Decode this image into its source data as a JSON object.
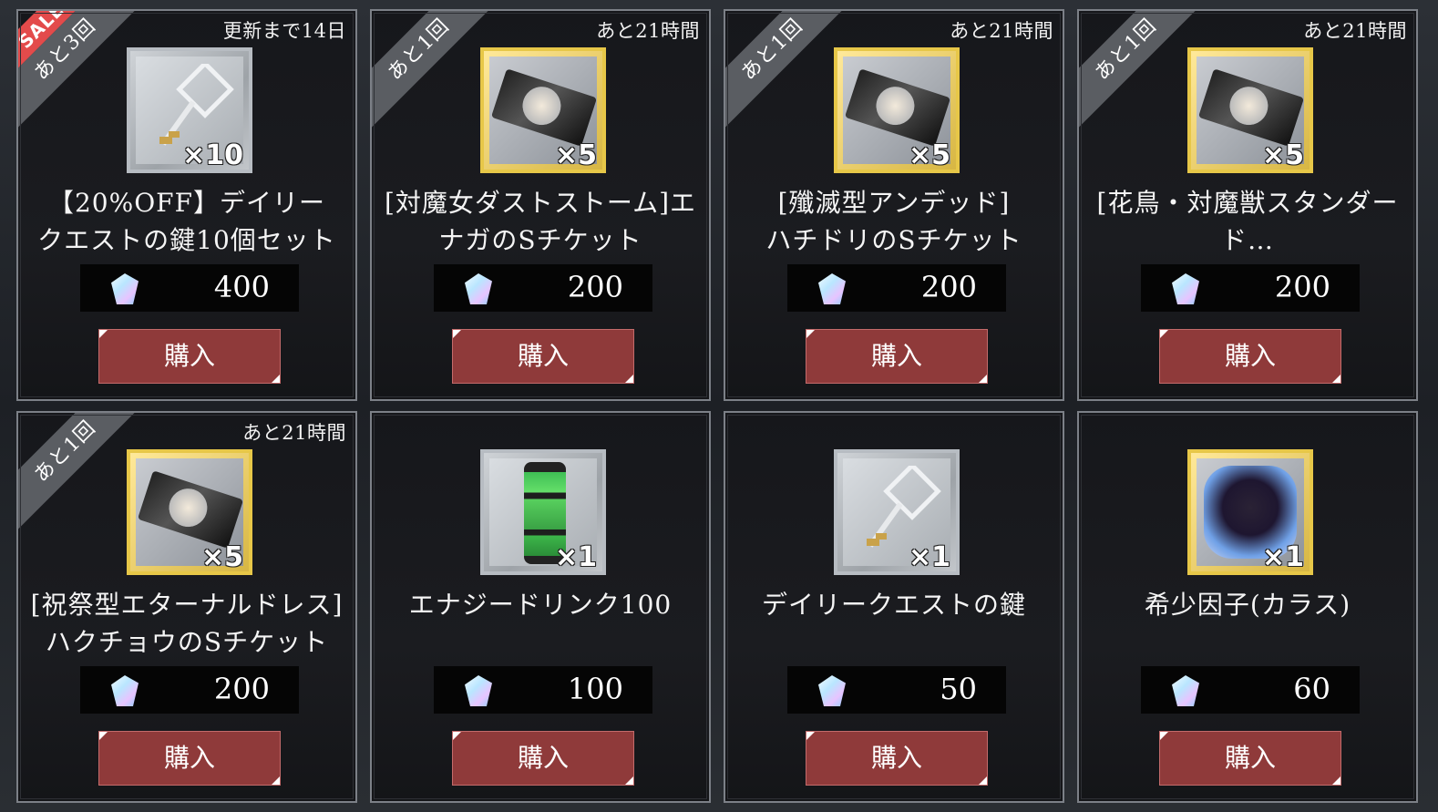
{
  "colors": {
    "buy_button": "#8f3a3a",
    "sale_badge": "#e34b4b",
    "ribbon": "#5a5d62",
    "gold_frame": "#e7c748",
    "silver_frame": "#b7bcc2"
  },
  "items": [
    {
      "ribbon": "あと3回",
      "sale": "SALE",
      "timer": "更新まで14日",
      "qty": "×10",
      "name1": "【20%OFF】デイリー",
      "name2": "クエストの鍵10個セット",
      "price": "400",
      "buy": "購入",
      "icon": "key-icon",
      "frame": "silver"
    },
    {
      "ribbon": "あと1回",
      "sale": "",
      "timer": "あと21時間",
      "qty": "×5",
      "name1": "[対魔女ダストストーム]エ",
      "name2": "ナガのSチケット",
      "price": "200",
      "buy": "購入",
      "icon": "ticket-icon",
      "frame": "gold"
    },
    {
      "ribbon": "あと1回",
      "sale": "",
      "timer": "あと21時間",
      "qty": "×5",
      "name1": "[殲滅型アンデッド]",
      "name2": "ハチドリのSチケット",
      "price": "200",
      "buy": "購入",
      "icon": "ticket-icon",
      "frame": "gold"
    },
    {
      "ribbon": "あと1回",
      "sale": "",
      "timer": "あと21時間",
      "qty": "×5",
      "name1": "[花鳥・対魔獣スタンダー",
      "name2": "ド…",
      "price": "200",
      "buy": "購入",
      "icon": "ticket-icon",
      "frame": "gold"
    },
    {
      "ribbon": "あと1回",
      "sale": "",
      "timer": "あと21時間",
      "qty": "×5",
      "name1": "[祝祭型エターナルドレス]",
      "name2": "ハクチョウのSチケット",
      "price": "200",
      "buy": "購入",
      "icon": "ticket-icon",
      "frame": "gold"
    },
    {
      "ribbon": "",
      "sale": "",
      "timer": "",
      "qty": "×1",
      "name1": "エナジードリンク100",
      "name2": "",
      "price": "100",
      "buy": "購入",
      "icon": "energy-drink-icon",
      "frame": "silver"
    },
    {
      "ribbon": "",
      "sale": "",
      "timer": "",
      "qty": "×1",
      "name1": "デイリークエストの鍵",
      "name2": "",
      "price": "50",
      "buy": "購入",
      "icon": "key-icon",
      "frame": "silver"
    },
    {
      "ribbon": "",
      "sale": "",
      "timer": "",
      "qty": "×1",
      "name1": "希少因子(カラス)",
      "name2": "",
      "price": "60",
      "buy": "購入",
      "icon": "crystal-icon",
      "frame": "gold"
    }
  ]
}
